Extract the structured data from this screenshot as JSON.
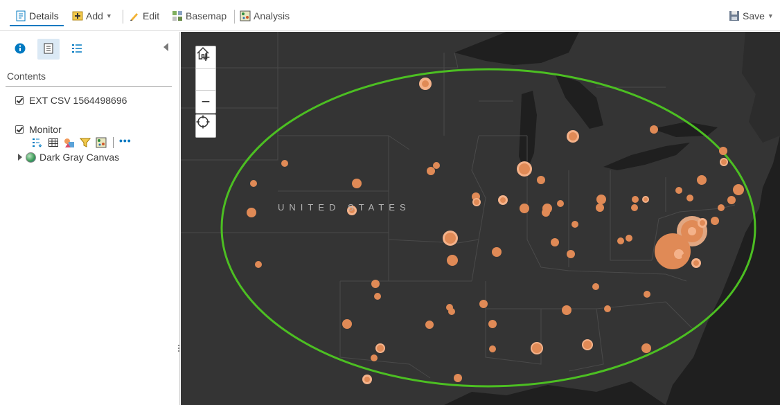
{
  "toolbar": {
    "details_label": "Details",
    "add_label": "Add",
    "edit_label": "Edit",
    "basemap_label": "Basemap",
    "analysis_label": "Analysis",
    "save_label": "Save"
  },
  "panel": {
    "contents_title": "Contents",
    "layers": [
      {
        "name": "EXT CSV 1564498696",
        "checked": true
      },
      {
        "name": "Monitor",
        "checked": true
      }
    ],
    "basemap_label": "Dark Gray Canvas"
  },
  "map": {
    "country_label": "UNITED STATES",
    "colors": {
      "background": "#343434",
      "water": "#1f1f1f",
      "borders": "#4a4a4a",
      "points": "#e08a56",
      "buffer_ring": "#4cbf22"
    }
  }
}
